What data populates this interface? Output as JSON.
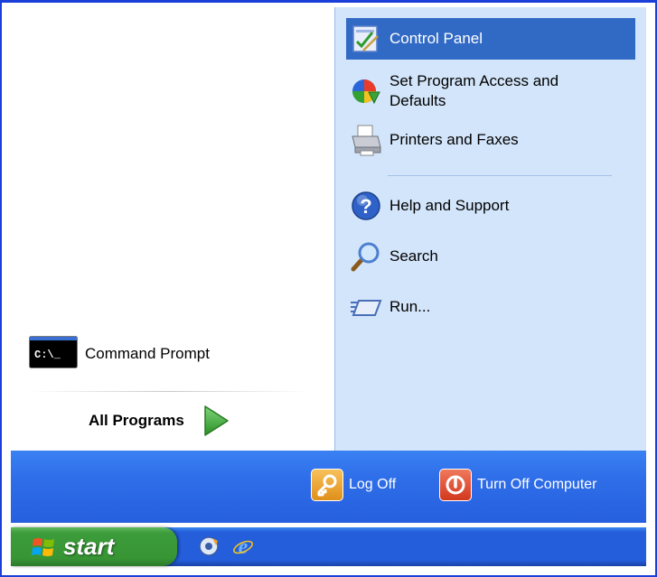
{
  "start_menu": {
    "right_column": {
      "items": [
        {
          "label": "Control Panel",
          "icon": "control-panel-icon",
          "selected": true
        },
        {
          "label": "Set Program Access and Defaults",
          "icon": "program-access-icon"
        },
        {
          "label": "Printers and Faxes",
          "icon": "printer-icon"
        },
        {
          "label": "Help and Support",
          "icon": "help-icon"
        },
        {
          "label": "Search",
          "icon": "search-icon"
        },
        {
          "label": "Run...",
          "icon": "run-icon"
        }
      ]
    },
    "left_column": {
      "pinned": [
        {
          "label": "Command Prompt",
          "icon": "command-prompt-icon",
          "icon_text": "C:\\_"
        }
      ],
      "all_programs_label": "All Programs"
    },
    "bottom_bar": {
      "log_off_label": "Log Off",
      "turn_off_label": "Turn Off Computer"
    }
  },
  "taskbar": {
    "start_label": "start",
    "quick_launch": [
      "media-icon",
      "internet-explorer-icon"
    ]
  },
  "colors": {
    "selection": "#316ac5",
    "right_panel": "#d3e5fa",
    "bottom_bar": "#2e6de8",
    "start_button": "#379534",
    "taskbar": "#245edb"
  }
}
